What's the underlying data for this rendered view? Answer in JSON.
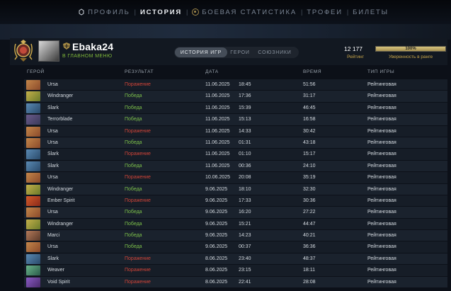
{
  "nav": {
    "items": [
      {
        "label": "ПРОФИЛЬ",
        "active": false,
        "icon": "fist-icon"
      },
      {
        "label": "ИСТОРИЯ",
        "active": true,
        "icon": ""
      },
      {
        "label": "БОЕВАЯ СТАТИСТИКА",
        "active": false,
        "icon": "target-icon"
      },
      {
        "label": "ТРОФЕИ",
        "active": false,
        "icon": ""
      },
      {
        "label": "БИЛЕТЫ",
        "active": false,
        "icon": ""
      }
    ]
  },
  "profile": {
    "username": "Ebaka24",
    "status": "В ГЛАВНОМ МЕНЮ",
    "rating_value": "12 177",
    "rating_label": "Рейтинг",
    "confidence_value": "100%",
    "confidence_fraction": 1.0,
    "confidence_label": "Уверенность в ранге"
  },
  "tabs": [
    {
      "label": "ИСТОРИЯ ИГР",
      "active": true
    },
    {
      "label": "ГЕРОИ",
      "active": false
    },
    {
      "label": "СОЮЗНИКИ",
      "active": false
    }
  ],
  "columns": {
    "hero": "ГЕРОЙ",
    "result": "РЕЗУЛЬТАТ",
    "date": "ДАТА",
    "duration": "ВРЕМЯ",
    "game_type": "ТИП ИГРЫ"
  },
  "colors": {
    "win": "#7cc04a",
    "loss": "#d04438",
    "accent_gold": "#c9a64a"
  },
  "matches": [
    {
      "hero": "Ursa",
      "result": "Поражение",
      "win": false,
      "date": "11.06.2025",
      "time": "18:45",
      "duration": "51:56",
      "type": "Рейтинговая"
    },
    {
      "hero": "Windranger",
      "result": "Победа",
      "win": true,
      "date": "11.06.2025",
      "time": "17:36",
      "duration": "31:17",
      "type": "Рейтинговая"
    },
    {
      "hero": "Slark",
      "result": "Победа",
      "win": true,
      "date": "11.06.2025",
      "time": "15:39",
      "duration": "46:45",
      "type": "Рейтинговая"
    },
    {
      "hero": "Terrorblade",
      "result": "Победа",
      "win": true,
      "date": "11.06.2025",
      "time": "15:13",
      "duration": "16:58",
      "type": "Рейтинговая"
    },
    {
      "hero": "Ursa",
      "result": "Поражение",
      "win": false,
      "date": "11.06.2025",
      "time": "14:33",
      "duration": "30:42",
      "type": "Рейтинговая"
    },
    {
      "hero": "Ursa",
      "result": "Победа",
      "win": true,
      "date": "11.06.2025",
      "time": "01:31",
      "duration": "43:18",
      "type": "Рейтинговая"
    },
    {
      "hero": "Slark",
      "result": "Поражение",
      "win": false,
      "date": "11.06.2025",
      "time": "01:10",
      "duration": "15:17",
      "type": "Рейтинговая"
    },
    {
      "hero": "Slark",
      "result": "Победа",
      "win": true,
      "date": "11.06.2025",
      "time": "00:36",
      "duration": "24:10",
      "type": "Рейтинговая"
    },
    {
      "hero": "Ursa",
      "result": "Поражение",
      "win": false,
      "date": "10.06.2025",
      "time": "20:08",
      "duration": "35:19",
      "type": "Рейтинговая"
    },
    {
      "hero": "Windranger",
      "result": "Победа",
      "win": true,
      "date": "9.06.2025",
      "time": "18:10",
      "duration": "32:30",
      "type": "Рейтинговая"
    },
    {
      "hero": "Ember Spirit",
      "result": "Поражение",
      "win": false,
      "date": "9.06.2025",
      "time": "17:33",
      "duration": "30:36",
      "type": "Рейтинговая"
    },
    {
      "hero": "Ursa",
      "result": "Победа",
      "win": true,
      "date": "9.06.2025",
      "time": "16:20",
      "duration": "27:22",
      "type": "Рейтинговая"
    },
    {
      "hero": "Windranger",
      "result": "Победа",
      "win": true,
      "date": "9.06.2025",
      "time": "15:21",
      "duration": "44:47",
      "type": "Рейтинговая"
    },
    {
      "hero": "Marci",
      "result": "Победа",
      "win": true,
      "date": "9.06.2025",
      "time": "14:23",
      "duration": "40:21",
      "type": "Рейтинговая"
    },
    {
      "hero": "Ursa",
      "result": "Победа",
      "win": true,
      "date": "9.06.2025",
      "time": "00:37",
      "duration": "36:36",
      "type": "Рейтинговая"
    },
    {
      "hero": "Slark",
      "result": "Поражение",
      "win": false,
      "date": "8.06.2025",
      "time": "23:40",
      "duration": "48:37",
      "type": "Рейтинговая"
    },
    {
      "hero": "Weaver",
      "result": "Поражение",
      "win": false,
      "date": "8.06.2025",
      "time": "23:15",
      "duration": "18:11",
      "type": "Рейтинговая"
    },
    {
      "hero": "Void Spirit",
      "result": "Поражение",
      "win": false,
      "date": "8.06.2025",
      "time": "22:41",
      "duration": "28:08",
      "type": "Рейтинговая"
    }
  ]
}
